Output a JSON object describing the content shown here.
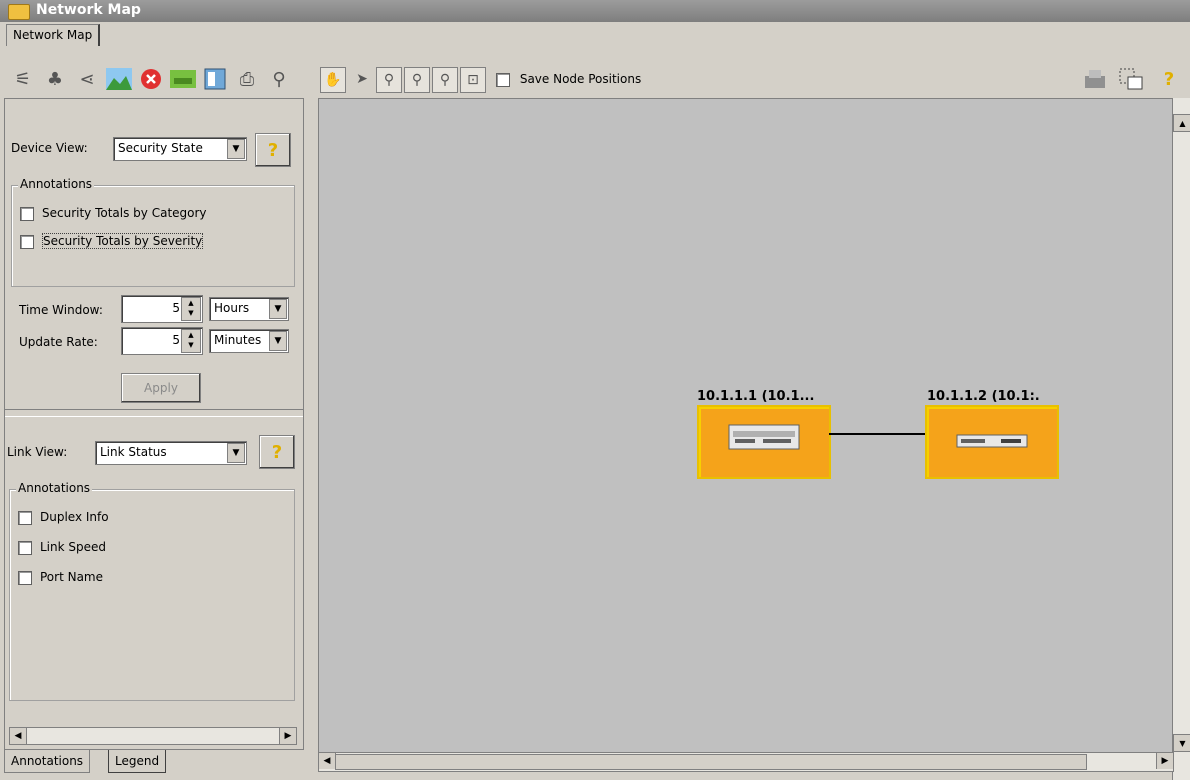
{
  "window": {
    "title": "Network Map"
  },
  "tabs": {
    "top_tab": "Network Map"
  },
  "toolbar": {
    "save_positions_label": "Save Node Positions",
    "left_icons": [
      "layout-icon",
      "tree-icon",
      "share-icon",
      "landscape-icon",
      "stop-icon",
      "green-device-icon",
      "window-icon",
      "print-icon",
      "search-icon"
    ],
    "boxed_icons": [
      "hand-icon",
      "pointer-icon",
      "zoom-area-icon",
      "zoom-in-icon",
      "zoom-out-icon",
      "fit-icon"
    ],
    "right_icons": [
      "printer-icon",
      "export-icon",
      "help-icon"
    ]
  },
  "device_panel": {
    "device_view_label": "Device View:",
    "device_view_value": "Security State",
    "annotations_title": "Annotations",
    "checkbox_category": "Security Totals by Category",
    "checkbox_severity": "Security Totals by Severity",
    "time_window_label": "Time Window:",
    "time_window_value": "5",
    "time_window_unit": "Hours",
    "update_rate_label": "Update Rate:",
    "update_rate_value": "5",
    "update_rate_unit": "Minutes",
    "apply_label": "Apply"
  },
  "link_panel": {
    "link_view_label": "Link View:",
    "link_view_value": "Link Status",
    "annotations_title": "Annotations",
    "checkbox_duplex": "Duplex Info",
    "checkbox_speed": "Link Speed",
    "checkbox_port": "Port Name"
  },
  "bottom_tabs": {
    "annotations": "Annotations",
    "legend": "Legend"
  },
  "map": {
    "nodes": [
      {
        "label": "10.1.1.1 (10.1...",
        "color": "#f5a31a"
      },
      {
        "label": "10.1.1.2 (10.1:.",
        "color": "#f5a31a"
      }
    ]
  }
}
